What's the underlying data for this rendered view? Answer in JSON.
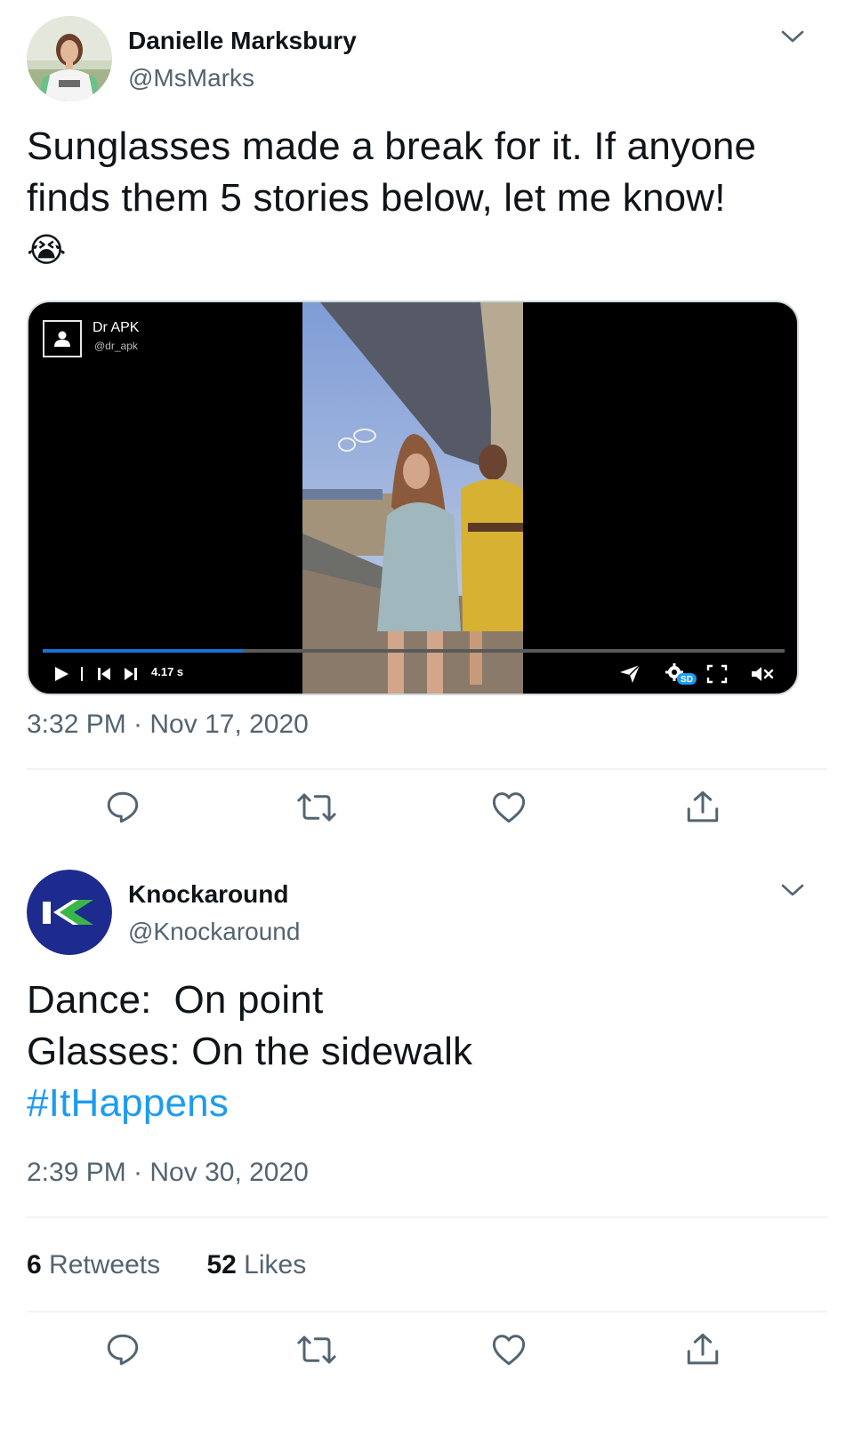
{
  "tweets": [
    {
      "author_name": "Danielle Marksbury",
      "author_handle": "@MsMarks",
      "text_line1": "Sunglasses made a break for it. If anyone",
      "text_line2": "finds them 5 stories below, let me know!",
      "emoji": "😭",
      "timestamp": "3:32 PM · Nov 17, 2020",
      "video": {
        "owner_name": "Dr APK",
        "owner_handle": "@dr_apk",
        "elapsed": "4.17 s",
        "progress_fraction": 0.27,
        "quality_badge": "SD"
      }
    },
    {
      "author_name": "Knockaround",
      "author_handle": "@Knockaround",
      "text_line1": "Dance:  On point",
      "text_line2": "Glasses: On the sidewalk",
      "hashtag": "#ItHappens",
      "timestamp": "2:39 PM · Nov 30, 2020",
      "retweets_count": "6",
      "retweets_label": "Retweets",
      "likes_count": "52",
      "likes_label": "Likes"
    }
  ],
  "icons": {
    "reply": "reply-icon",
    "retweet": "retweet-icon",
    "like": "heart-icon",
    "share": "share-icon",
    "more": "chevron-down-icon"
  },
  "colors": {
    "accent": "#1d9bf0",
    "secondary_text": "#536471",
    "divider": "#eff3f4",
    "knockaround_brand": "#1d2b8f",
    "knockaround_green": "#39b54a"
  }
}
